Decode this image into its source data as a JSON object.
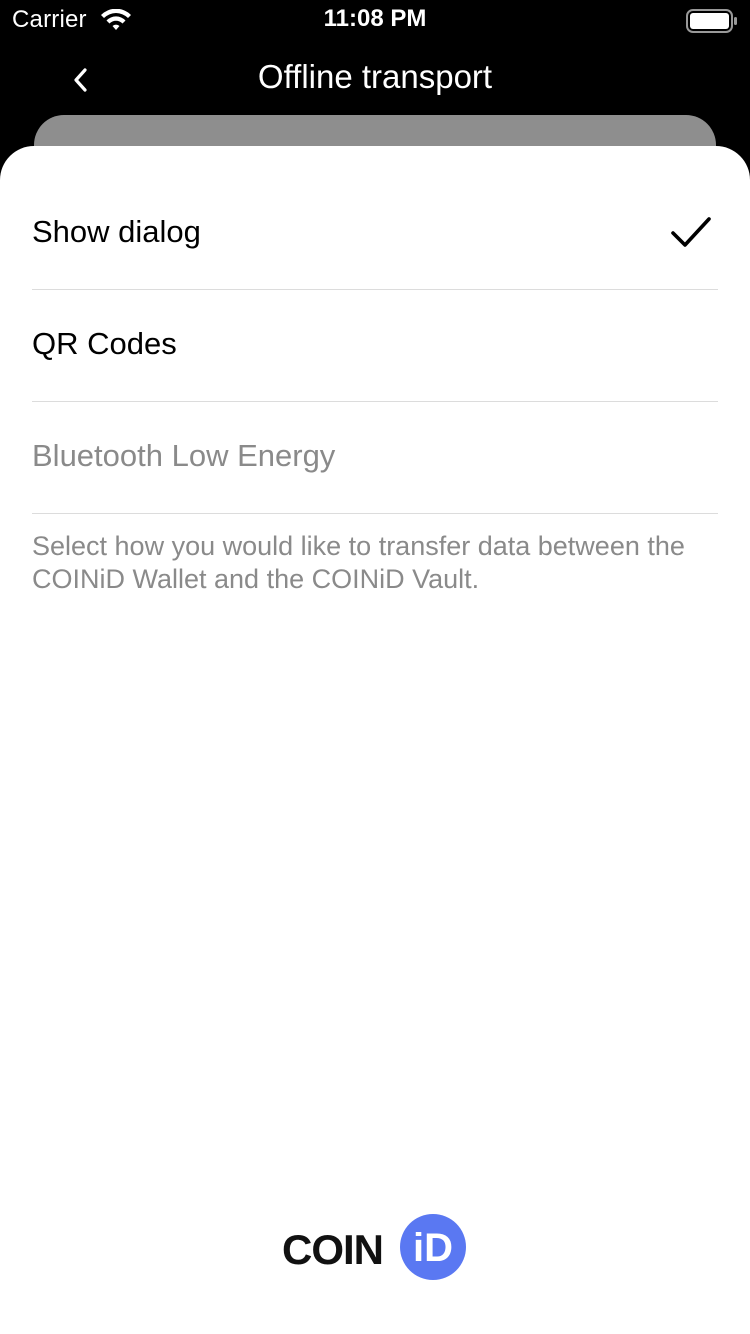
{
  "status_bar": {
    "carrier": "Carrier",
    "time": "11:08 PM"
  },
  "nav": {
    "title": "Offline transport",
    "back_icon": "chevron-left-icon"
  },
  "options": [
    {
      "label": "Show dialog",
      "selected": true,
      "enabled": true
    },
    {
      "label": "QR Codes",
      "selected": false,
      "enabled": true
    },
    {
      "label": "Bluetooth Low Energy",
      "selected": false,
      "enabled": false
    }
  ],
  "description": "Select how you would like to transfer data between the COINiD Wallet and the COINiD Vault.",
  "logo": {
    "text": "COIN",
    "badge": "iD"
  },
  "colors": {
    "background": "#000000",
    "sheet": "#ffffff",
    "disabled_text": "#8a8a8a",
    "brand_accent": "#5a78f2"
  }
}
